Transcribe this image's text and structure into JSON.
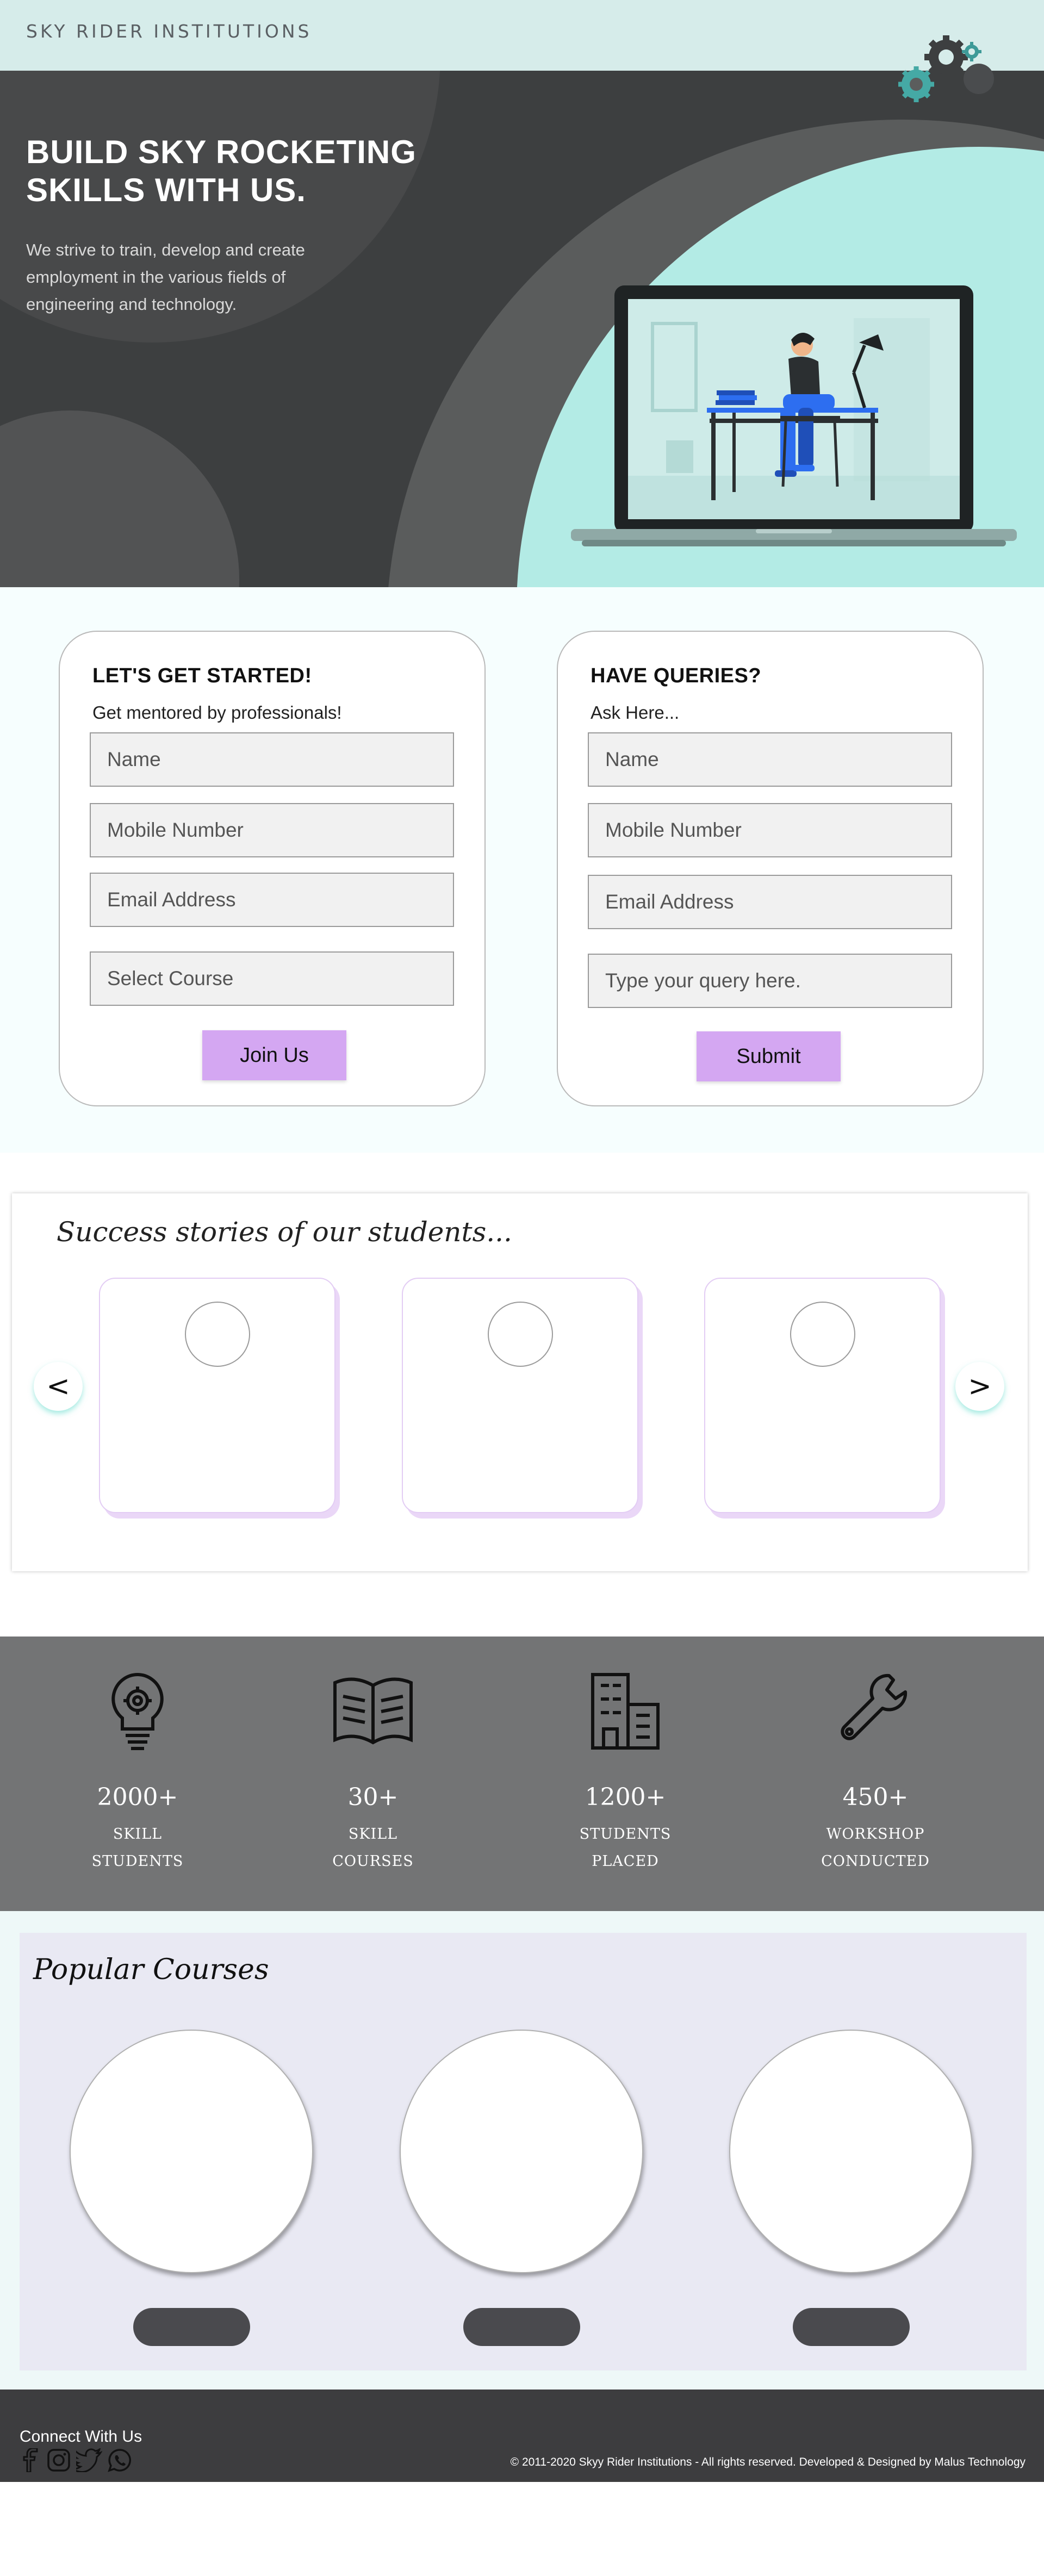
{
  "brand": {
    "name": "SKY RIDER INSTITUTIONS"
  },
  "hero": {
    "title_line1": "BUILD SKY ROCKETING",
    "title_line2": "SKILLS WITH US.",
    "subtitle_line1": "We strive to train, develop and create",
    "subtitle_line2": "employment in the various fields of",
    "subtitle_line3": "engineering and technology."
  },
  "join_form": {
    "heading": "LET'S GET STARTED!",
    "subheading": "Get mentored by professionals!",
    "name_placeholder": "Name",
    "mobile_placeholder": "Mobile Number",
    "email_placeholder": "Email Address",
    "course_placeholder": "Select Course",
    "submit_label": "Join Us"
  },
  "query_form": {
    "heading": "HAVE QUERIES?",
    "subheading": "Ask Here...",
    "name_placeholder": "Name",
    "mobile_placeholder": "Mobile Number",
    "email_placeholder": "Email Address",
    "query_placeholder": "Type your query here.",
    "submit_label": "Submit"
  },
  "stories": {
    "heading": "Success stories of our students...",
    "prev_label": "<",
    "next_label": ">"
  },
  "stats": [
    {
      "number": "2000+",
      "label_line1": "SKILL",
      "label_line2": "STUDENTS",
      "icon": "lightbulb-gear-icon"
    },
    {
      "number": "30+",
      "label_line1": "SKILL",
      "label_line2": "COURSES",
      "icon": "open-book-icon"
    },
    {
      "number": "1200+",
      "label_line1": "STUDENTS",
      "label_line2": "PLACED",
      "icon": "buildings-icon"
    },
    {
      "number": "450+",
      "label_line1": "WORKSHOP",
      "label_line2": "CONDUCTED",
      "icon": "wrench-icon"
    }
  ],
  "courses": {
    "heading": "Popular Courses"
  },
  "footer": {
    "connect": "Connect With Us",
    "copyright": "© 2011-2020 Skyy Rider Institutions - All rights reserved. Developed & Designed by Malus Technology",
    "social_icons": [
      "facebook-icon",
      "instagram-icon",
      "twitter-icon",
      "whatsapp-icon"
    ]
  },
  "colors": {
    "accent_teal": "#b3ebe5",
    "dark_bg": "#3d3f40",
    "button_purple": "#d4a7f2",
    "stats_bg": "#737475",
    "footer_bg": "#3d3d3f"
  }
}
